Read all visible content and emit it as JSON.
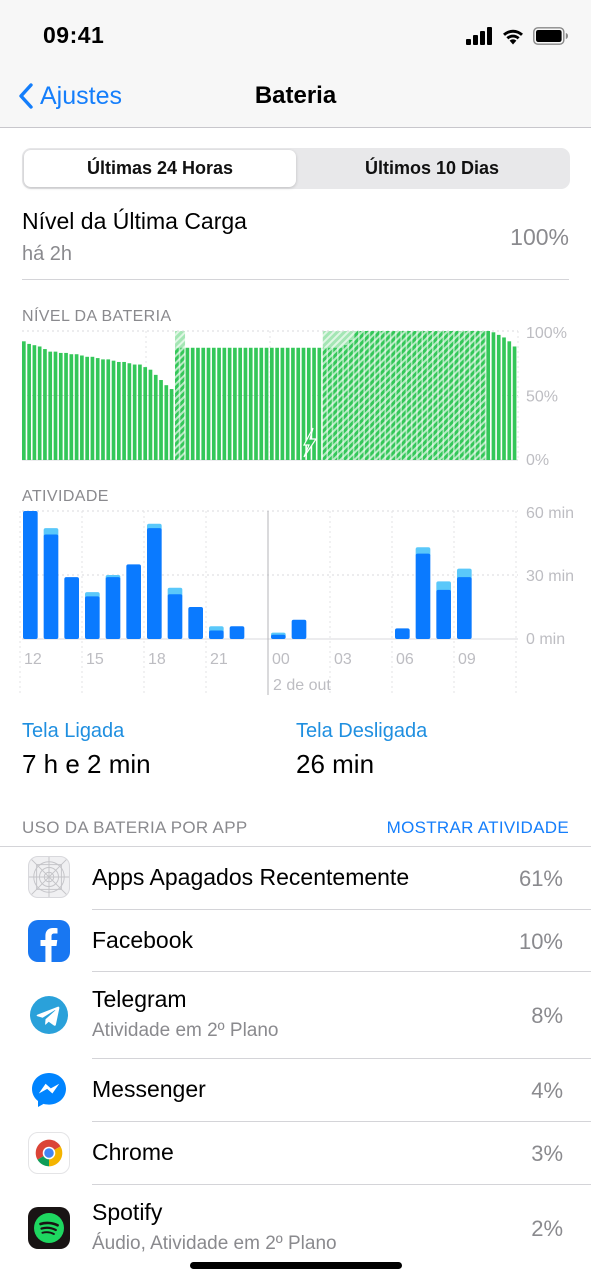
{
  "status_bar": {
    "time": "09:41"
  },
  "nav": {
    "back_label": "Ajustes",
    "title": "Bateria"
  },
  "segments": [
    {
      "label": "Últimas 24 Horas",
      "active": true
    },
    {
      "label": "Últimos 10 Dias",
      "active": false
    }
  ],
  "last_charge": {
    "title": "Nível da Última Carga",
    "ago": "há 2h",
    "percent": "100%"
  },
  "battery_section_label": "NÍVEL DA BATERIA",
  "activity_section_label": "ATIVIDADE",
  "chart_data": [
    {
      "type": "bar",
      "title": "NÍVEL DA BATERIA",
      "ylim": [
        0,
        100
      ],
      "y_tick_labels": [
        "100%",
        "50%",
        "0%"
      ],
      "grid": true,
      "color": "#34c759",
      "values": [
        92,
        90,
        89,
        88,
        86,
        84,
        84,
        83,
        83,
        82,
        82,
        81,
        80,
        80,
        79,
        78,
        78,
        77,
        76,
        76,
        75,
        74,
        74,
        72,
        70,
        66,
        62,
        58,
        55,
        87,
        87,
        87,
        87,
        87,
        87,
        87,
        87,
        87,
        87,
        87,
        87,
        87,
        87,
        87,
        87,
        87,
        87,
        87,
        87,
        87,
        87,
        87,
        87,
        87,
        87,
        87,
        87,
        87,
        87,
        87,
        87,
        89,
        93,
        100,
        100,
        100,
        100,
        100,
        100,
        100,
        100,
        100,
        100,
        100,
        100,
        100,
        100,
        100,
        100,
        100,
        100,
        100,
        100,
        100,
        100,
        100,
        100,
        100,
        100,
        99,
        97,
        95,
        92,
        88
      ],
      "charging_ranges": [
        [
          29,
          30
        ],
        [
          57,
          87
        ]
      ],
      "charging_icon": "lightning-icon"
    },
    {
      "type": "bar",
      "title": "ATIVIDADE",
      "ylim": [
        0,
        60
      ],
      "y_tick_labels": [
        "60 min",
        "30 min",
        "0 min"
      ],
      "x_tick_labels": [
        "12",
        "15",
        "18",
        "21",
        "00",
        "03",
        "06",
        "09"
      ],
      "x_sublabel": "2 de out",
      "grid": true,
      "series": [
        {
          "name": "Tela Ligada",
          "color": "#0a7aff"
        },
        {
          "name": "Tela Desligada",
          "color": "#5ac8fa"
        }
      ],
      "bars": [
        {
          "hour": "12",
          "on": 60,
          "off": 0
        },
        {
          "hour": "13",
          "on": 49,
          "off": 3
        },
        {
          "hour": "14",
          "on": 29,
          "off": 0
        },
        {
          "hour": "15",
          "on": 20,
          "off": 2
        },
        {
          "hour": "16",
          "on": 29,
          "off": 1
        },
        {
          "hour": "17",
          "on": 35,
          "off": 0
        },
        {
          "hour": "18",
          "on": 52,
          "off": 2
        },
        {
          "hour": "19",
          "on": 21,
          "off": 3
        },
        {
          "hour": "20",
          "on": 15,
          "off": 0
        },
        {
          "hour": "21",
          "on": 4,
          "off": 2
        },
        {
          "hour": "22",
          "on": 6,
          "off": 0
        },
        {
          "hour": "00",
          "on": 2,
          "off": 1
        },
        {
          "hour": "01",
          "on": 9,
          "off": 0
        },
        {
          "hour": "06",
          "on": 5,
          "off": 0
        },
        {
          "hour": "07",
          "on": 40,
          "off": 3
        },
        {
          "hour": "08",
          "on": 23,
          "off": 4
        },
        {
          "hour": "09",
          "on": 29,
          "off": 4
        }
      ]
    }
  ],
  "screen_stats": {
    "on_label": "Tela Ligada",
    "on_value": "7 h e 2 min",
    "off_label": "Tela Desligada",
    "off_value": "26 min"
  },
  "app_list": {
    "header": "USO DA BATERIA POR APP",
    "action": "MOSTRAR ATIVIDADE",
    "apps": [
      {
        "name": "Apps Apagados Recentemente",
        "sub": "",
        "percent": "61%",
        "icon": "app-placeholder-icon"
      },
      {
        "name": "Facebook",
        "sub": "",
        "percent": "10%",
        "icon": "facebook-icon"
      },
      {
        "name": "Telegram",
        "sub": "Atividade em 2º Plano",
        "percent": "8%",
        "icon": "telegram-icon"
      },
      {
        "name": "Messenger",
        "sub": "",
        "percent": "4%",
        "icon": "messenger-icon"
      },
      {
        "name": "Chrome",
        "sub": "",
        "percent": "3%",
        "icon": "chrome-icon"
      },
      {
        "name": "Spotify",
        "sub": "Áudio, Atividade em 2º Plano",
        "percent": "2%",
        "icon": "spotify-icon"
      }
    ]
  }
}
